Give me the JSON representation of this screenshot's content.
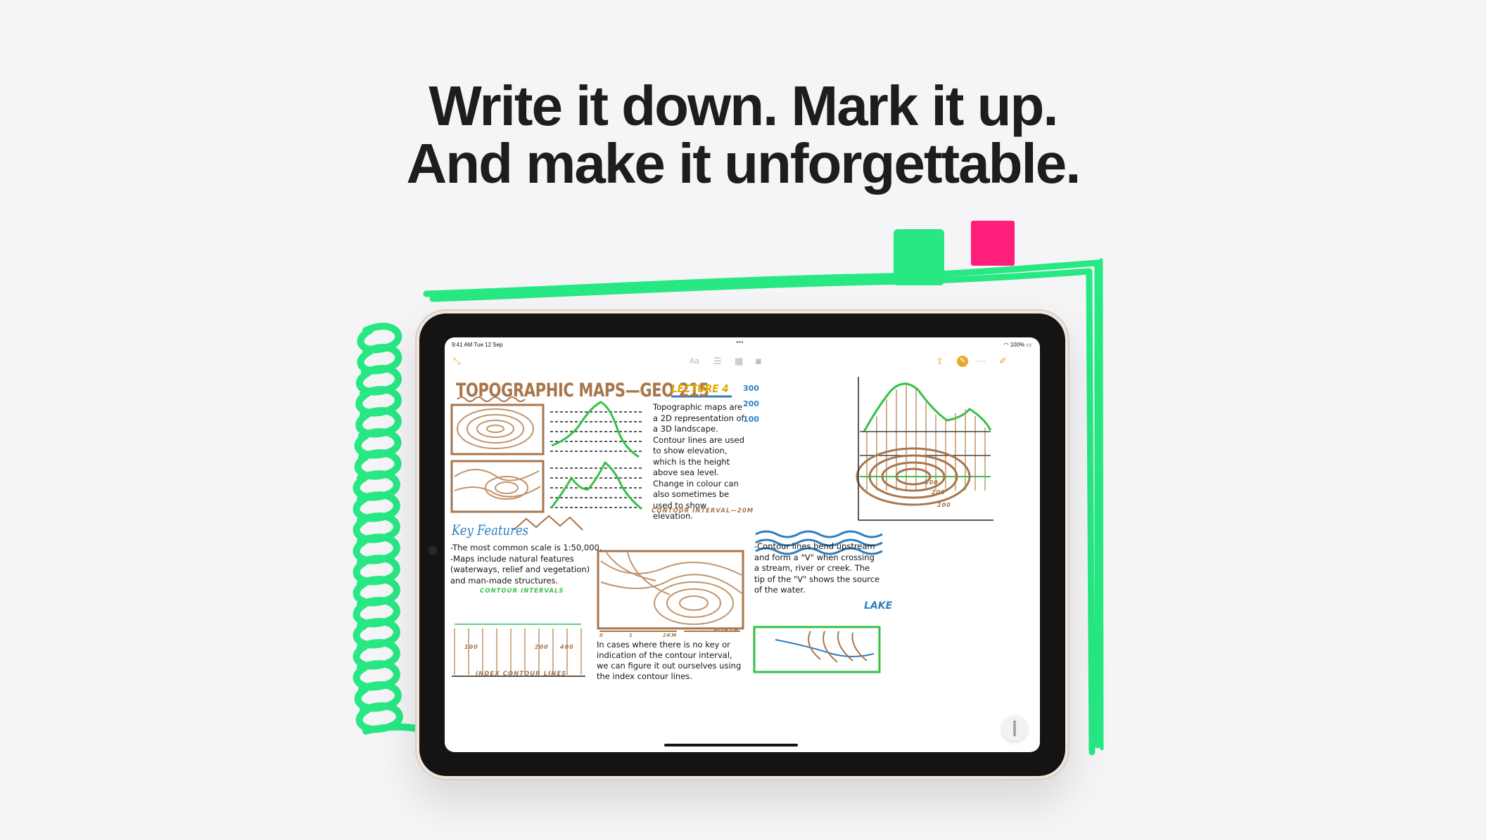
{
  "headline": {
    "line1": "Write it down. Mark it up.",
    "line2": "And make it unforgettable."
  },
  "status_bar": {
    "time": "9:41 AM   Tue 12 Sep",
    "battery": "100%"
  },
  "toolbar": {
    "collapse_icon": "collapse-arrows-icon",
    "format_label": "Aa",
    "checklist_icon": "checklist-icon",
    "table_icon": "table-icon",
    "camera_icon": "camera-icon",
    "share_icon": "share-icon",
    "markup_icon": "markup-pen-icon",
    "more_icon": "ellipsis-icon",
    "compose_icon": "compose-icon"
  },
  "note": {
    "title": "TOPOGRAPHIC MAPS—GEO 215",
    "lecture": "LECTURE 4",
    "elevation_labels": [
      "300",
      "200",
      "100"
    ],
    "intro_text": "Topographic maps are a 2D representation of a 3D landscape. Contour lines are used to show elevation, which is the height above sea level. Change in colour can also sometimes be used to show elevation.",
    "contour_interval_caption": "CONTOUR INTERVAL—20M",
    "key_features_heading": "Key Features",
    "key_features_text": [
      "-The most common scale is 1:50,000.",
      "-Maps include natural features",
      "(waterways, relief and vegetation)",
      "and man-made structures."
    ],
    "contour_intervals_caption": "CONTOUR INTERVALS",
    "index_contour_caption": "INDEX CONTOUR LINES",
    "index_values": [
      "100",
      "200",
      "400"
    ],
    "scale_marks": [
      "0",
      "1",
      "2KM"
    ],
    "north_label": "NORTH",
    "no_key_text": [
      "In cases where there is no key or",
      "indication of the contour interval,",
      "we can figure it out ourselves using",
      "the index contour lines."
    ],
    "ring_labels": [
      "300",
      "200",
      "200"
    ],
    "stream_text": [
      "-Contour lines bend upstream",
      "and form a \"V\" when crossing",
      "a stream, river or creek. The",
      "tip of the \"V\" shows the source",
      "of the water."
    ],
    "lake_label": "LAKE"
  }
}
